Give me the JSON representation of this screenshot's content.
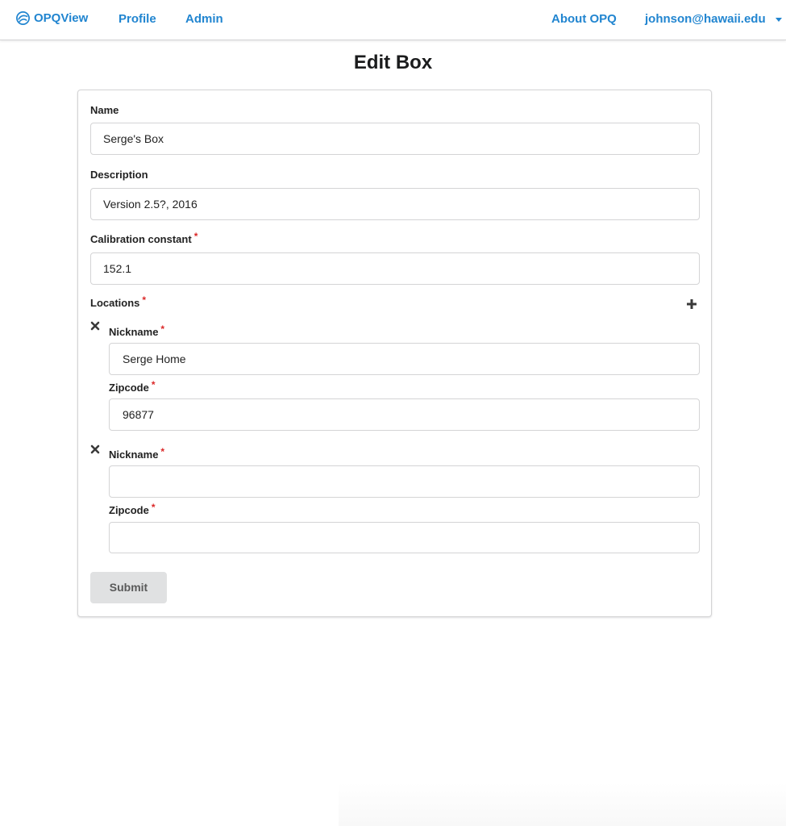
{
  "nav": {
    "brand": "OPQView",
    "profile": "Profile",
    "admin": "Admin",
    "about": "About OPQ",
    "user": "johnson@hawaii.edu",
    "accent_color": "#2185d0"
  },
  "page": {
    "title": "Edit Box"
  },
  "form": {
    "name": {
      "label": "Name",
      "value": "Serge's Box"
    },
    "description": {
      "label": "Description",
      "value": "Version 2.5?, 2016"
    },
    "calibration": {
      "label": "Calibration constant",
      "required_mark": "*",
      "value": "152.1"
    },
    "locations": {
      "label": "Locations",
      "required_mark": "*",
      "add_icon": "plus-icon",
      "items": [
        {
          "remove_icon": "close-icon",
          "nickname_label": "Nickname",
          "nickname_required": "*",
          "nickname_value": "Serge Home",
          "zipcode_label": "Zipcode",
          "zipcode_required": "*",
          "zipcode_value": "96877"
        },
        {
          "remove_icon": "close-icon",
          "nickname_label": "Nickname",
          "nickname_required": "*",
          "nickname_value": "",
          "zipcode_label": "Zipcode",
          "zipcode_required": "*",
          "zipcode_value": ""
        }
      ]
    },
    "submit_label": "Submit",
    "required_color": "#db2828"
  }
}
